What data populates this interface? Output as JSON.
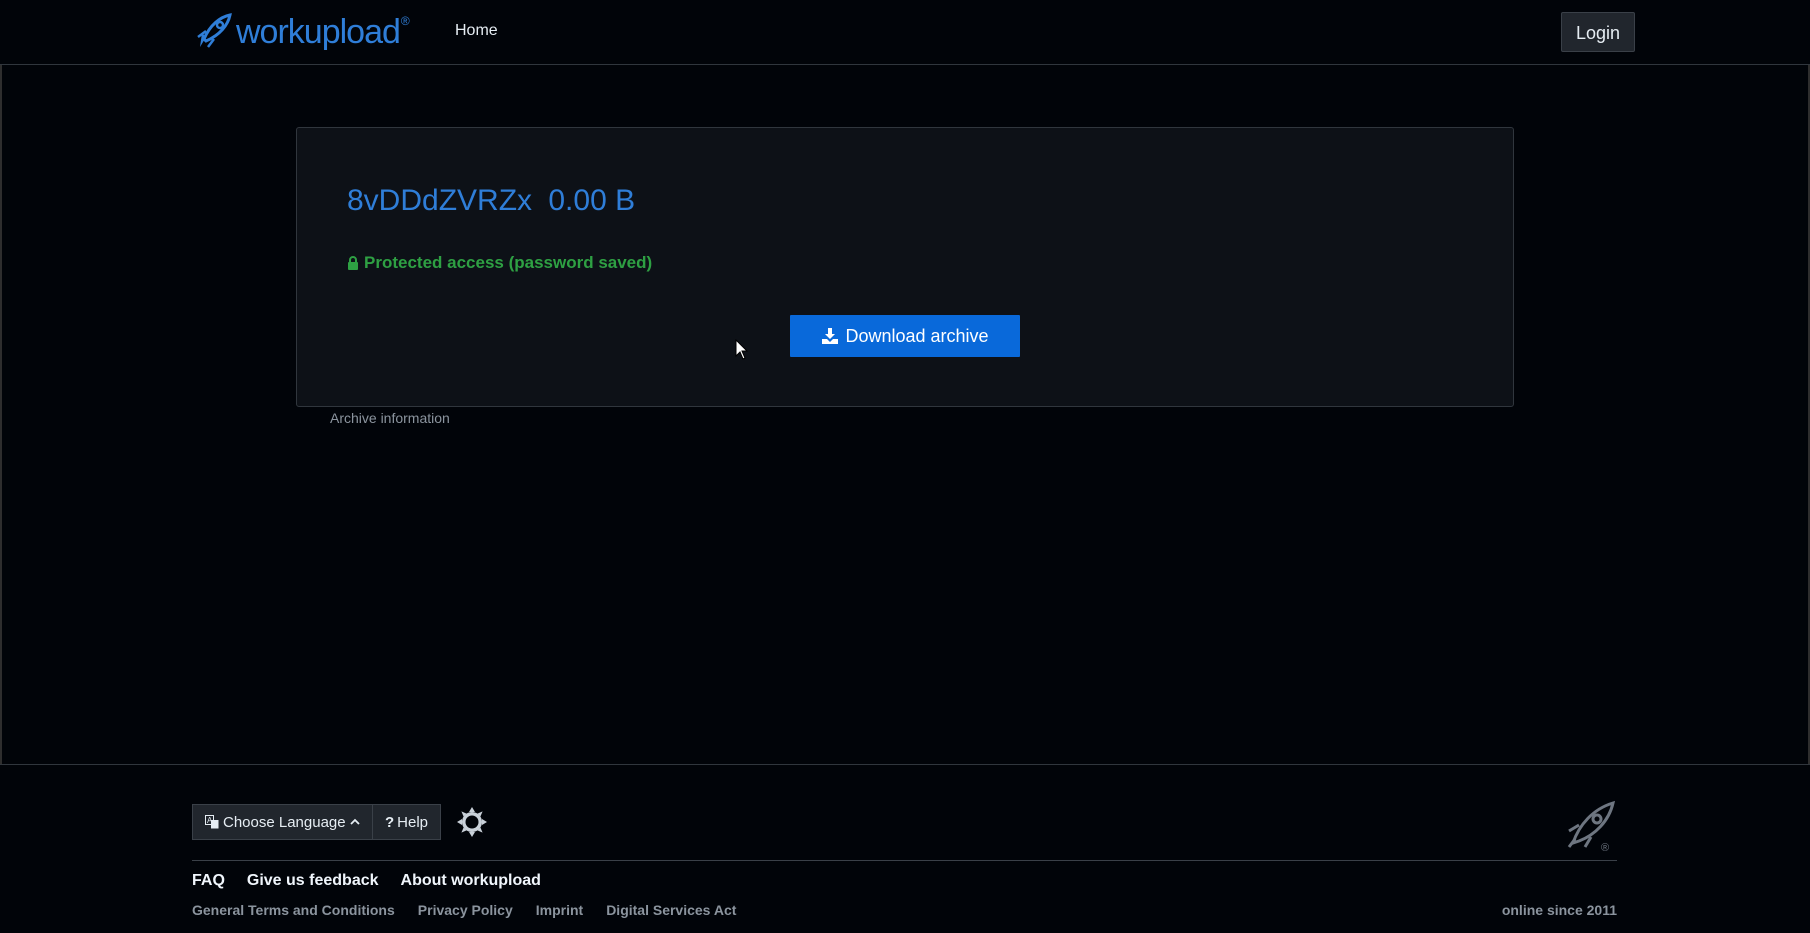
{
  "header": {
    "logo_text": "workupload",
    "logo_registered": "®",
    "nav_home": "Home",
    "login_label": "Login"
  },
  "file": {
    "name": "8vDDdZVRZx",
    "size": "0.00 B",
    "protected_text": "Protected access (password saved)",
    "download_label": "Download archive",
    "archive_info_label": "Archive information"
  },
  "footer": {
    "language_label": "Choose Language",
    "help_label": "Help",
    "help_glyph": "?",
    "links_main": [
      "FAQ",
      "Give us feedback",
      "About workupload"
    ],
    "links_secondary": [
      "General Terms and Conditions",
      "Privacy Policy",
      "Imprint",
      "Digital Services Act"
    ],
    "online_since": "online since 2011",
    "rocket_registered": "®"
  },
  "icons": {
    "lock": "lock-icon",
    "download": "download-icon",
    "language": "language-icon",
    "caret": "chevron-up-icon",
    "theme": "brightness-icon",
    "cursor": "mouse-cursor-icon"
  },
  "colors": {
    "background": "#010409",
    "card": "#0d1117",
    "accent_blue": "#2f7ed8",
    "button_blue": "#0969da",
    "success_green": "#2ea043"
  }
}
